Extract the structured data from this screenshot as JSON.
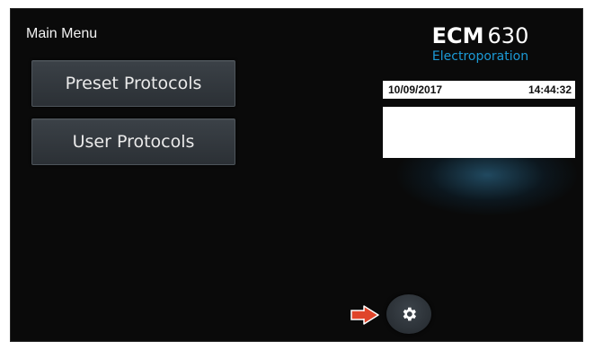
{
  "header": {
    "title": "Main Menu"
  },
  "buttons": {
    "preset_label": "Preset Protocols",
    "user_label": "User Protocols"
  },
  "brand": {
    "name_bold": "ECM",
    "name_model": "630",
    "subtitle": "Electroporation"
  },
  "status": {
    "date": "10/09/2017",
    "time": "14:44:32"
  },
  "icons": {
    "settings": "gear-icon",
    "pointer": "arrow-right-icon"
  },
  "colors": {
    "background": "#0a0a0a",
    "accent": "#1c9ad6",
    "button": "#353b41",
    "arrow": "#e0452b"
  }
}
